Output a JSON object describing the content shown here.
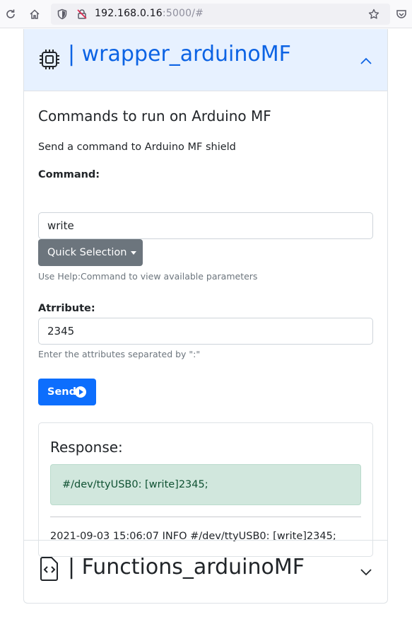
{
  "browser": {
    "url_host": "192.168.0.16",
    "url_rest": ":5000/#"
  },
  "accordion": {
    "item1_title": "| wrapper_arduinoMF",
    "item2_title": "| Functions_arduinoMF"
  },
  "commands": {
    "heading": "Commands to run on Arduino MF",
    "description": "Send a command to Arduino MF shield",
    "command_label": "Command:",
    "command_value": "write",
    "quick_selection_label": "Quick Selection",
    "command_help": "Use Help:Command to view available parameters",
    "attribute_label": "Atrribute:",
    "attribute_value": "2345",
    "attribute_help": "Enter the attributes separated by \":\"",
    "send_label": "Send"
  },
  "response": {
    "title": "Response:",
    "alert_text": "#/dev/ttyUSB0: [write]2345;",
    "log_line": "2021-09-03 15:06:07 INFO #/dev/ttyUSB0: [write]2345;"
  },
  "colors": {
    "accent": "#0d6efd",
    "header_active_bg": "#e7f1ff",
    "header_active_text": "#0c63e4",
    "secondary": "#6c757d",
    "success_bg": "#d1e7dd",
    "success_text": "#0f5132"
  },
  "icons": [
    "reload-icon",
    "home-icon",
    "shield-icon",
    "insecure-lock-icon",
    "bookmark-star-icon",
    "pocket-icon",
    "cpu-icon",
    "chevron-up-icon",
    "file-code-icon",
    "chevron-down-icon",
    "play-circle-icon",
    "caret-down-icon"
  ]
}
